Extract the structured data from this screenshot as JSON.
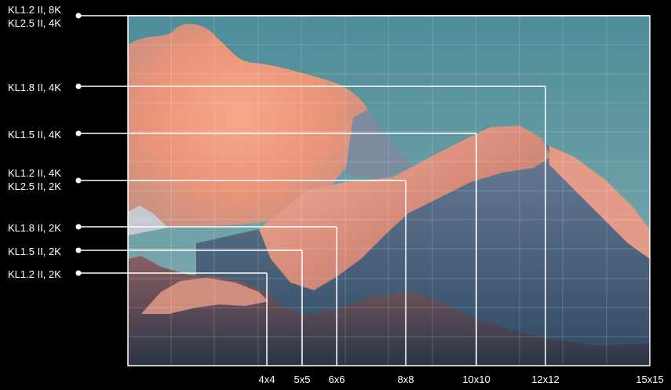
{
  "levels": [
    {
      "lines": [
        "KL1.2 II, 8K",
        "KL2.5 II, 4K"
      ],
      "size": "15x15"
    },
    {
      "lines": [
        "KL1.8 II, 4K"
      ],
      "size": "12x12"
    },
    {
      "lines": [
        "KL1.5 II, 4K"
      ],
      "size": "10x10"
    },
    {
      "lines": [
        "KL1.2 II, 4K",
        "KL2.5 II, 2K"
      ],
      "size": "8x8"
    },
    {
      "lines": [
        "KL1.8 II, 2K"
      ],
      "size": "6x6"
    },
    {
      "lines": [
        "KL1.5 II, 2K"
      ],
      "size": "5x5"
    },
    {
      "lines": [
        "KL1.2 II, 2K"
      ],
      "size": "4x4"
    }
  ],
  "sizes": [
    "4x4",
    "5x5",
    "6x6",
    "8x8",
    "10x10",
    "12x12",
    "15x15"
  ],
  "colors": {
    "background": "#000000",
    "line": "#ffffff",
    "label": "#ffffff"
  }
}
